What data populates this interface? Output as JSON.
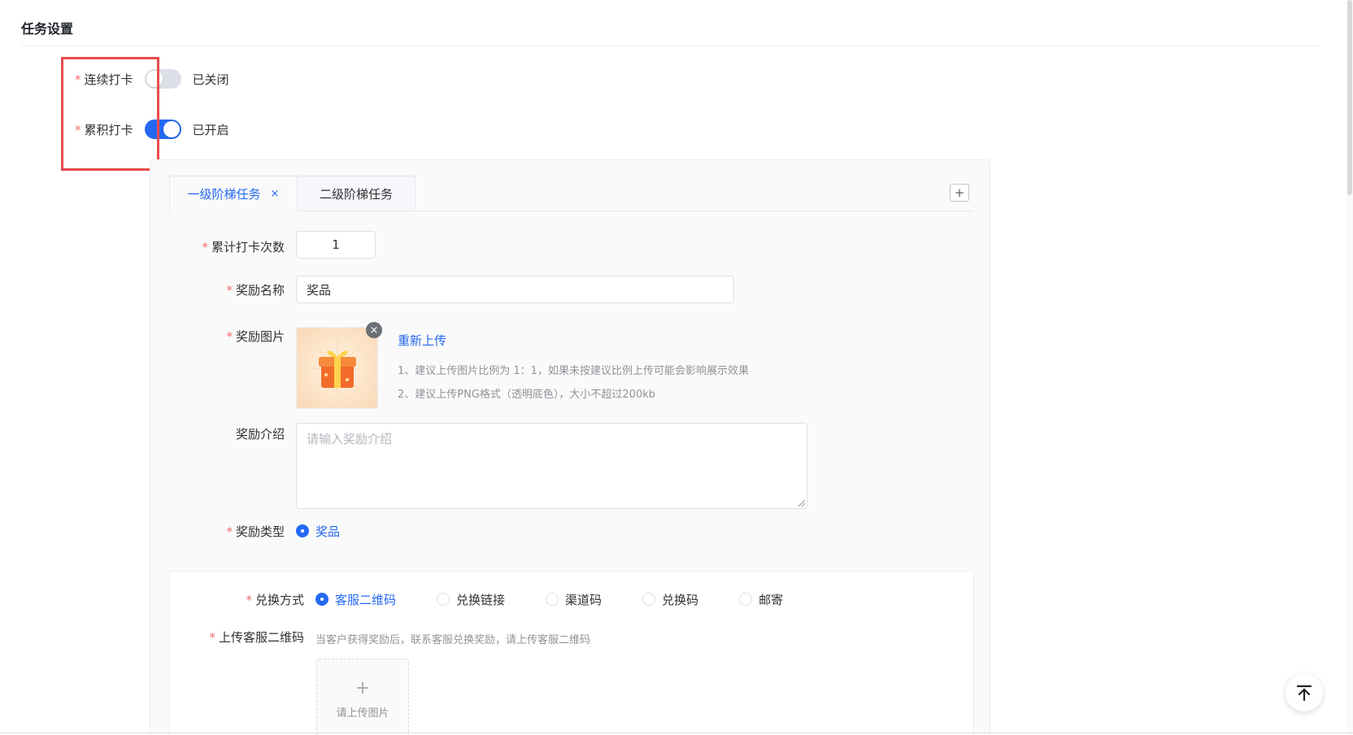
{
  "section": {
    "title": "任务设置"
  },
  "toggles": [
    {
      "label": "连续打卡",
      "state": "已关闭",
      "on": false
    },
    {
      "label": "累积打卡",
      "state": "已开启",
      "on": true
    }
  ],
  "tabs": {
    "items": [
      {
        "label": "一级阶梯任务",
        "active": true,
        "close": "×"
      },
      {
        "label": "二级阶梯任务",
        "active": false
      }
    ],
    "add": "+"
  },
  "form": {
    "count": {
      "label": "累计打卡次数",
      "value": "1"
    },
    "name": {
      "label": "奖励名称",
      "value": "奖品"
    },
    "image": {
      "label": "奖励图片",
      "reupload": "重新上传",
      "hint1": "1、建议上传图片比例为 1：1，如果未按建议比例上传可能会影响展示效果",
      "hint2": "2、建议上传PNG格式（透明底色），大小不超过200kb",
      "close": "×"
    },
    "intro": {
      "label": "奖励介绍",
      "placeholder": "请输入奖励介绍"
    },
    "type": {
      "label": "奖励类型",
      "option": "奖品"
    }
  },
  "redeem": {
    "label": "兑换方式",
    "options": [
      {
        "label": "客服二维码",
        "checked": true
      },
      {
        "label": "兑换链接",
        "checked": false
      },
      {
        "label": "渠道码",
        "checked": false
      },
      {
        "label": "兑换码",
        "checked": false
      },
      {
        "label": "邮寄",
        "checked": false
      }
    ],
    "qr": {
      "label": "上传客服二维码",
      "hint": "当客户获得奖励后，联系客服兑换奖励，请上传客服二维码",
      "upload_plus": "+",
      "upload_text": "请上传图片"
    }
  },
  "required_mark": "*",
  "colors": {
    "primary": "#2468f2",
    "required": "#f56c6c",
    "highlight": "#e94b4b"
  },
  "icons": {
    "scroll_top": "arrow-up-to-top-icon",
    "gift": "gift-icon"
  }
}
